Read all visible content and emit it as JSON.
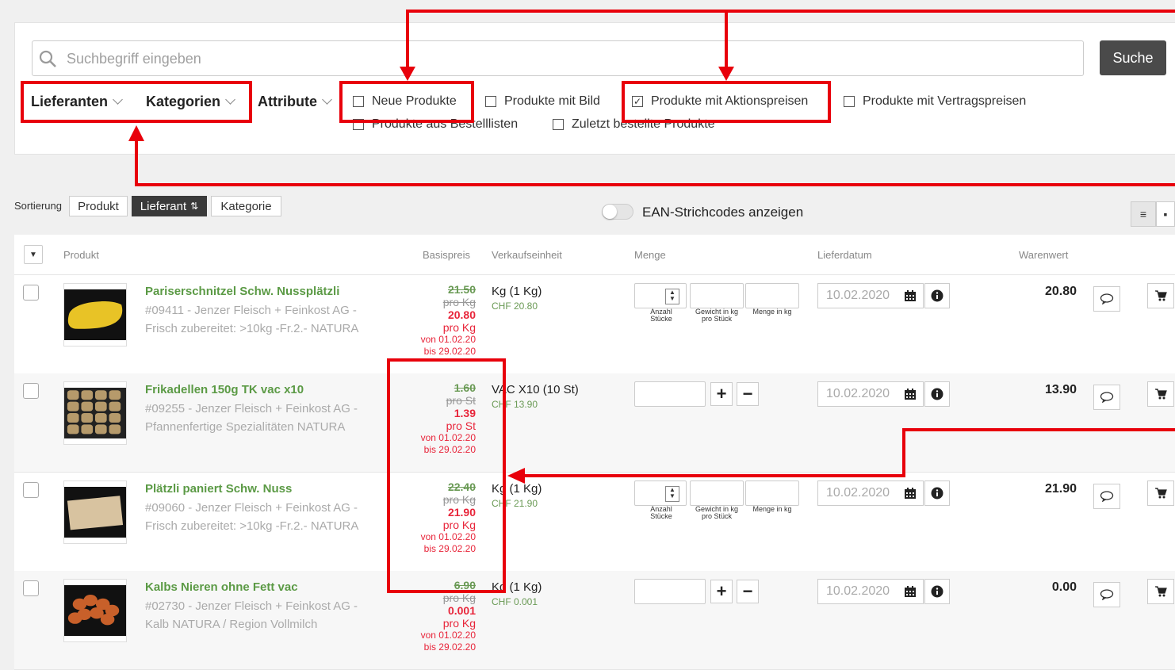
{
  "search": {
    "placeholder": "Suchbegriff eingeben",
    "button": "Suche"
  },
  "filters": {
    "dropdowns": [
      "Lieferanten",
      "Kategorien",
      "Attribute"
    ],
    "checkboxes": [
      {
        "label": "Neue Produkte",
        "checked": false
      },
      {
        "label": "Produkte mit Bild",
        "checked": false
      },
      {
        "label": "Produkte mit Aktionspreisen",
        "checked": true
      },
      {
        "label": "Produkte mit Vertragspreisen",
        "checked": false
      },
      {
        "label": "Produkte aus Bestelllisten",
        "checked": false
      },
      {
        "label": "Zuletzt bestellte Produkte",
        "checked": false
      }
    ]
  },
  "sort": {
    "label": "Sortierung",
    "options": [
      "Produkt",
      "Lieferant",
      "Kategorie"
    ],
    "active": "Lieferant"
  },
  "ean_toggle": "EAN-Strichcodes anzeigen",
  "table": {
    "headers": [
      "Produkt",
      "Basispreis",
      "Verkaufseinheit",
      "Menge",
      "Lieferdatum",
      "Warenwert"
    ],
    "qty_labels": {
      "anzahl": "Anzahl Stücke",
      "gewicht": "Gewicht in kg pro Stück",
      "menge": "Menge in kg"
    },
    "rows": [
      {
        "name": "Pariserschnitzel Schw. Nussplätzli",
        "desc": "#09411 - Jenzer Fleisch + Feinkost AG - Frisch zubereitet: >10kg -Fr.2.- NATURA",
        "old_price": "21.50",
        "old_unit": "pro Kg",
        "new_price": "20.80",
        "new_unit": "pro Kg",
        "valid_from": "von 01.02.20",
        "valid_to": "bis 29.02.20",
        "unit": "Kg (1 Kg)",
        "unit_chf": "CHF 20.80",
        "date": "10.02.2020",
        "warenwert": "20.80",
        "qty_type": "weight"
      },
      {
        "name": "Frikadellen 150g TK vac x10",
        "desc": "#09255 - Jenzer Fleisch + Feinkost AG - Pfannenfertige Spezialitäten NATURA",
        "old_price": "1.60",
        "old_unit": "pro St",
        "new_price": "1.39",
        "new_unit": "pro St",
        "valid_from": "von 01.02.20",
        "valid_to": "bis 29.02.20",
        "unit": "VAC X10 (10 St)",
        "unit_chf": "CHF 13.90",
        "date": "10.02.2020",
        "warenwert": "13.90",
        "qty_type": "count"
      },
      {
        "name": "Plätzli paniert Schw. Nuss",
        "desc": "#09060 - Jenzer Fleisch + Feinkost AG - Frisch zubereitet: >10kg -Fr.2.- NATURA",
        "old_price": "22.40",
        "old_unit": "pro Kg",
        "new_price": "21.90",
        "new_unit": "pro Kg",
        "valid_from": "von 01.02.20",
        "valid_to": "bis 29.02.20",
        "unit": "Kg (1 Kg)",
        "unit_chf": "CHF 21.90",
        "date": "10.02.2020",
        "warenwert": "21.90",
        "qty_type": "weight"
      },
      {
        "name": "Kalbs Nieren ohne Fett vac",
        "desc": "#02730 - Jenzer Fleisch + Feinkost AG - Kalb NATURA / Region Vollmilch",
        "old_price": "6.90",
        "old_unit": "pro Kg",
        "new_price": "0.001",
        "new_unit": "pro Kg",
        "valid_from": "von 01.02.20",
        "valid_to": "bis 29.02.20",
        "unit": "Kg (1 Kg)",
        "unit_chf": "CHF 0.001",
        "date": "10.02.2020",
        "warenwert": "0.00",
        "qty_type": "count"
      }
    ]
  },
  "colors": {
    "annotation": "#e8000b",
    "product_name": "#5b9a45",
    "promo_price": "#e8253a"
  }
}
